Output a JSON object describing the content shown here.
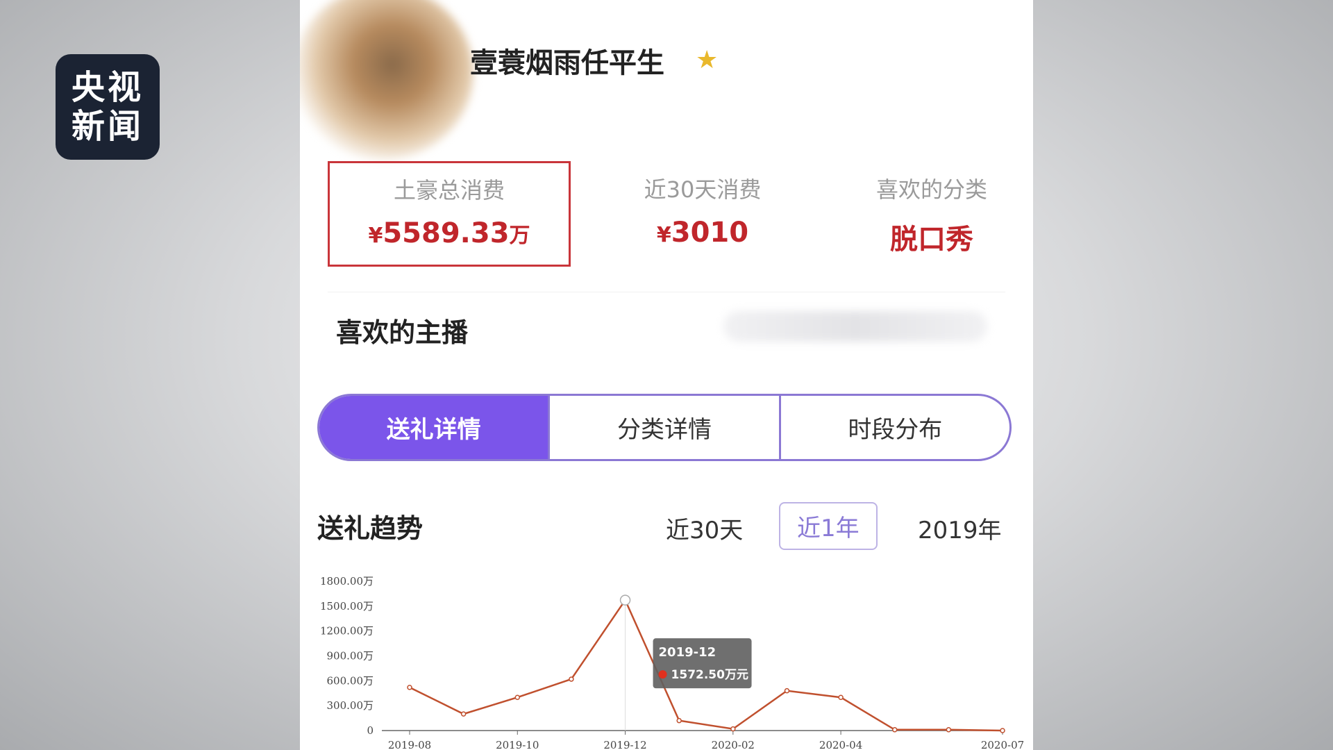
{
  "watermark": {
    "line1": "央视",
    "line2": "新闻"
  },
  "profile": {
    "username": "壹蓑烟雨任平生",
    "badge_icon": "star-icon"
  },
  "stats": [
    {
      "label": "土豪总消费",
      "prefix": "¥",
      "value": "5589.33",
      "unit": "万"
    },
    {
      "label": "近30天消费",
      "prefix": "¥",
      "value": "3010",
      "unit": ""
    },
    {
      "label": "喜欢的分类",
      "value": "脱口秀"
    }
  ],
  "favorite_anchor": {
    "label": "喜欢的主播"
  },
  "tabs": [
    {
      "label": "送礼详情",
      "active": true
    },
    {
      "label": "分类详情",
      "active": false
    },
    {
      "label": "时段分布",
      "active": false
    }
  ],
  "trend": {
    "title": "送礼趋势",
    "ranges": [
      {
        "label": "近30天",
        "active": false
      },
      {
        "label": "近1年",
        "active": true
      },
      {
        "label": "2019年",
        "active": false
      }
    ]
  },
  "chart_data": {
    "type": "line",
    "x": [
      "2019-08",
      "2019-09",
      "2019-10",
      "2019-11",
      "2019-12",
      "2020-01",
      "2020-02",
      "2020-03",
      "2020-04",
      "2020-05",
      "2020-06",
      "2020-07"
    ],
    "x_tick_labels": [
      "2019-08",
      "2019-10",
      "2019-12",
      "2020-02",
      "2020-04",
      "2020-07"
    ],
    "y_tick_labels": [
      "0",
      "300.00万",
      "600.00万",
      "900.00万",
      "1200.00万",
      "1500.00万",
      "1800.00万"
    ],
    "ylim": [
      0,
      1800
    ],
    "series": [
      {
        "values": [
          520,
          200,
          400,
          620,
          1572.5,
          120,
          20,
          480,
          400,
          10,
          10,
          0
        ],
        "color": "#c0502e"
      }
    ],
    "tooltip": {
      "date": "2019-12",
      "value_label": "1572.50万元"
    }
  }
}
